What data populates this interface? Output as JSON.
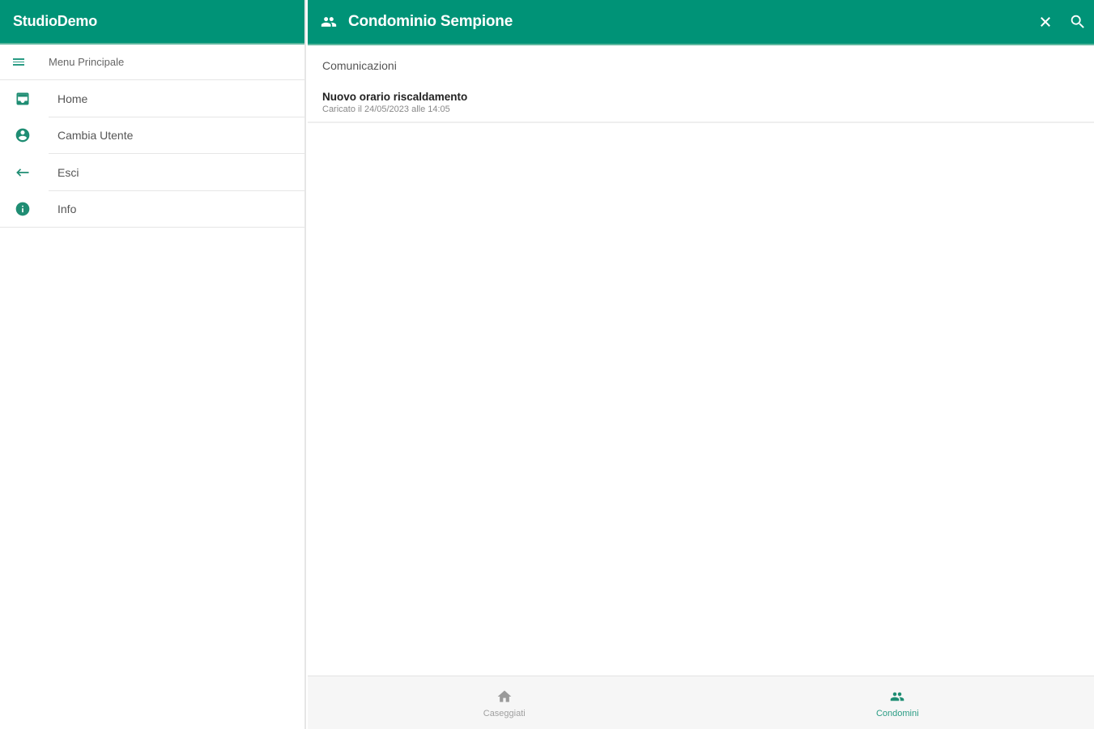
{
  "app": {
    "title": "StudioDemo",
    "brand_color": "#009377"
  },
  "sidebar": {
    "heading": "Menu Principale",
    "heading_icon": "menu-icon",
    "items": [
      {
        "label": "Home",
        "icon": "inbox-icon"
      },
      {
        "label": "Cambia Utente",
        "icon": "account-circle-icon"
      },
      {
        "label": "Esci",
        "icon": "arrow-back-icon"
      },
      {
        "label": "Info",
        "icon": "info-icon"
      }
    ]
  },
  "header": {
    "title": "Condominio Sempione",
    "icon": "people-icon",
    "actions": [
      "close-icon",
      "search-icon"
    ]
  },
  "main": {
    "section_title": "Comunicazioni",
    "communications": [
      {
        "title": "Nuovo orario riscaldamento",
        "subtitle": "Caricato il 24/05/2023 alle 14:05"
      }
    ]
  },
  "bottom_nav": {
    "tabs": [
      {
        "label": "Caseggiati",
        "icon": "home-icon",
        "active": false
      },
      {
        "label": "Condomini",
        "icon": "people-icon",
        "active": true
      }
    ]
  }
}
